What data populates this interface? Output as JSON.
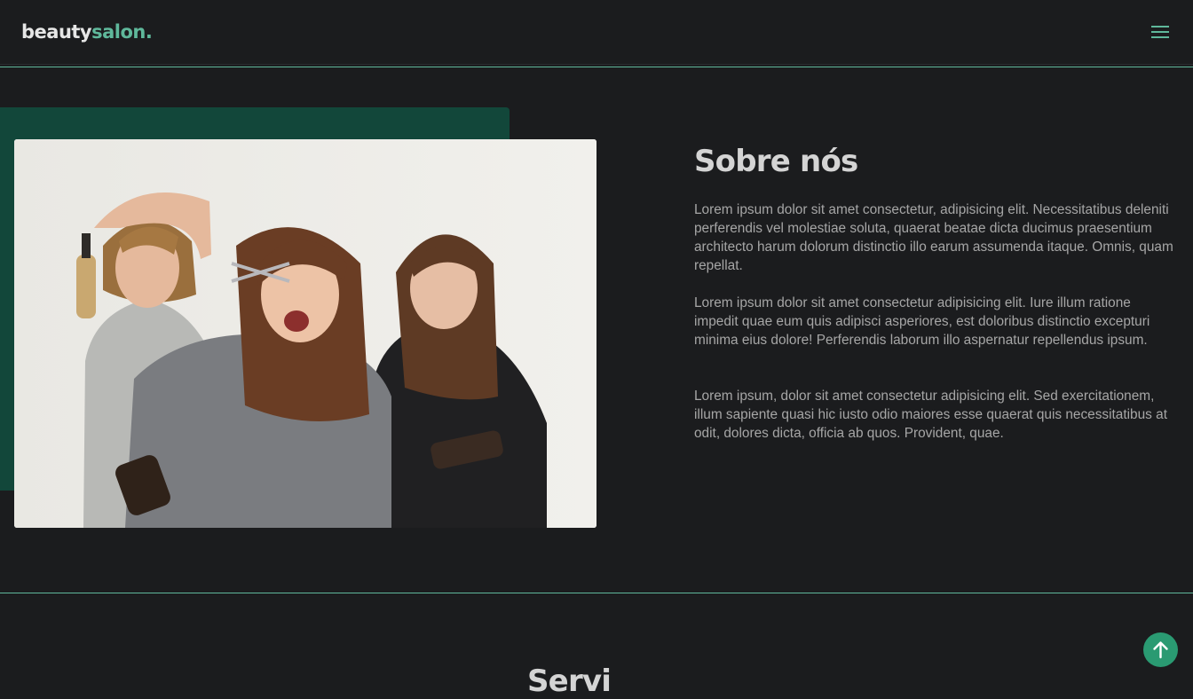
{
  "header": {
    "logo_part1": "beauty",
    "logo_part2": "salon",
    "logo_dot": ".",
    "menu_icon": "hamburger-menu-icon"
  },
  "about": {
    "title": "Sobre nós",
    "paragraphs": [
      "Lorem ipsum dolor sit amet consectetur, adipisicing elit. Necessitatibus deleniti perferendis vel molestiae soluta, quaerat beatae dicta ducimus praesentium architecto harum dolorum distinctio illo earum assumenda itaque. Omnis, quam repellat.",
      "Lorem ipsum dolor sit amet consectetur adipisicing elit. Iure illum ratione impedit quae eum quis adipisci asperiores, est doloribus distinctio excepturi minima eius dolore! Perferendis laborum illo aspernatur repellendus ipsum.",
      "Lorem ipsum, dolor sit amet consectetur adipisicing elit. Sed exercitationem, illum sapiente quasi hic iusto odio maiores esse quaerat quis necessitatibus at odit, dolores dicta, officia ab quos. Provident, quae."
    ]
  },
  "next_section": {
    "title_partial": "Servi"
  },
  "scroll_top": {
    "icon": "arrow-up-icon"
  },
  "colors": {
    "background": "#1b1c1e",
    "accent": "#5fb89b",
    "green_block": "#12473a",
    "button": "#2a9a72"
  }
}
